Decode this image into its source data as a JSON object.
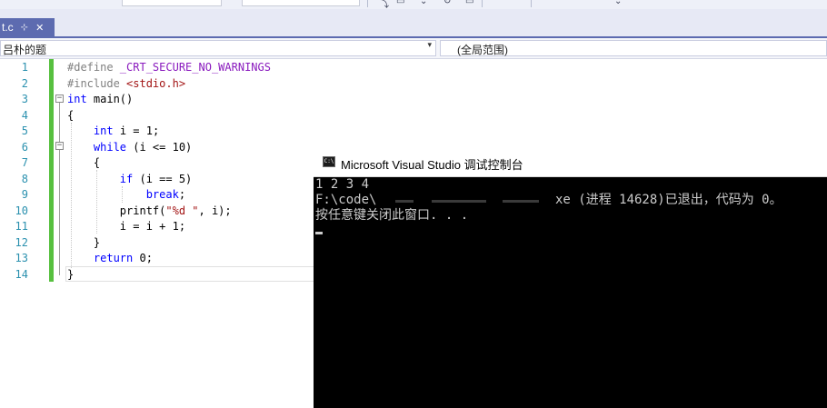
{
  "tab": {
    "name": "t.c",
    "pin_glyph": "⊹",
    "close_glyph": "✕"
  },
  "nav": {
    "scope": "吕朴的题",
    "member": "(全局范围)",
    "arrow": "▾"
  },
  "editor": {
    "lines": [
      {
        "num": "1",
        "tokens": [
          {
            "t": "#define ",
            "c": "pp"
          },
          {
            "t": "_CRT_SECURE_NO_WARNINGS",
            "c": "mac"
          }
        ]
      },
      {
        "num": "2",
        "tokens": [
          {
            "t": "#include ",
            "c": "pp"
          },
          {
            "t": "<stdio.h>",
            "c": "inc"
          }
        ]
      },
      {
        "num": "3",
        "tokens": [
          {
            "t": "int",
            "c": "kw"
          },
          {
            "t": " main()",
            "c": ""
          }
        ]
      },
      {
        "num": "4",
        "tokens": [
          {
            "t": "{",
            "c": ""
          }
        ]
      },
      {
        "num": "5",
        "tokens": [
          {
            "t": "    ",
            "c": ""
          },
          {
            "t": "int",
            "c": "kw"
          },
          {
            "t": " i = 1;",
            "c": ""
          }
        ]
      },
      {
        "num": "6",
        "tokens": [
          {
            "t": "    ",
            "c": ""
          },
          {
            "t": "while",
            "c": "kw"
          },
          {
            "t": " (i <= 10)",
            "c": ""
          }
        ]
      },
      {
        "num": "7",
        "tokens": [
          {
            "t": "    {",
            "c": ""
          }
        ]
      },
      {
        "num": "8",
        "tokens": [
          {
            "t": "        ",
            "c": ""
          },
          {
            "t": "if",
            "c": "kw"
          },
          {
            "t": " (i == 5)",
            "c": ""
          }
        ]
      },
      {
        "num": "9",
        "tokens": [
          {
            "t": "            ",
            "c": ""
          },
          {
            "t": "break",
            "c": "kw"
          },
          {
            "t": ";",
            "c": ""
          }
        ]
      },
      {
        "num": "10",
        "tokens": [
          {
            "t": "        printf(",
            "c": ""
          },
          {
            "t": "\"%d \"",
            "c": "str"
          },
          {
            "t": ", i);",
            "c": ""
          }
        ]
      },
      {
        "num": "11",
        "tokens": [
          {
            "t": "        i = i + 1;",
            "c": ""
          }
        ]
      },
      {
        "num": "12",
        "tokens": [
          {
            "t": "    }",
            "c": ""
          }
        ]
      },
      {
        "num": "13",
        "tokens": [
          {
            "t": "    ",
            "c": ""
          },
          {
            "t": "return",
            "c": "kw"
          },
          {
            "t": " 0;",
            "c": ""
          }
        ]
      },
      {
        "num": "14",
        "tokens": [
          {
            "t": "}",
            "c": ""
          }
        ]
      }
    ]
  },
  "console": {
    "title": "Microsoft Visual Studio 调试控制台",
    "icon_text": "C:\\",
    "line1": "1 2 3 4",
    "line2_prefix": "F:\\code\\",
    "line2_suffix": "xe (进程 14628)已退出，代码为 0。",
    "line3": "按任意键关闭此窗口. . ."
  }
}
